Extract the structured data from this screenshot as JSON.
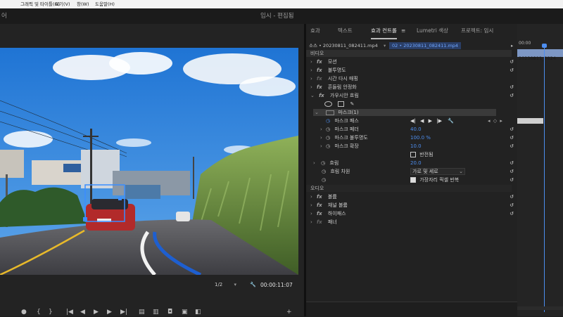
{
  "menubar": {
    "items": [
      "그래픽 및 타이틀(G)",
      "보기(V)",
      "창(W)",
      "도움말(H)"
    ]
  },
  "titlebar": {
    "left_text": "어",
    "title": "임시 - 편집됨"
  },
  "program": {
    "zoom": "1/2",
    "timecode": "00:00:11:07",
    "mask_box_label": "마스크(1)"
  },
  "effect_controls": {
    "tabs": [
      "효과",
      "텍스트",
      "효과 컨트롤",
      "Lumetri 색상",
      "프로젝트: 임시"
    ],
    "active_tab_index": 2,
    "source_label": "소스 • 20230811_082411.mp4",
    "clip_label": "02 • 20230811_082411.mp4",
    "video_section": "비디오",
    "audio_section": "오디오",
    "effects_top": [
      "모션",
      "불투명도",
      "시간 다시 매핑",
      "흔들림 안정화",
      "가우시안 흐림"
    ],
    "mask_name": "마스크(1)",
    "mask_path_label": "마스크 패스",
    "mask_params": [
      {
        "label": "마스크 페더",
        "value": "40.0"
      },
      {
        "label": "마스크 불투명도",
        "value": "100.0 %"
      },
      {
        "label": "마스크 확장",
        "value": "10.0"
      }
    ],
    "inverted_label": "반전됨",
    "blur_label": "흐림",
    "blur_value": "20.0",
    "blur_dims_label": "흐림 차원",
    "blur_dims_value": "가로 및 세로",
    "repeat_edge_label": "가장자리 픽셀 반복",
    "audio_effects": [
      "볼륨",
      "채널 볼륨",
      "패너"
    ],
    "audio_third": "하이패스"
  },
  "timeline": {
    "start_time": "00:00",
    "clip_label": "20230811_0824"
  },
  "colors": {
    "accent": "#4d8ef0",
    "sky": "#2f80d8"
  }
}
